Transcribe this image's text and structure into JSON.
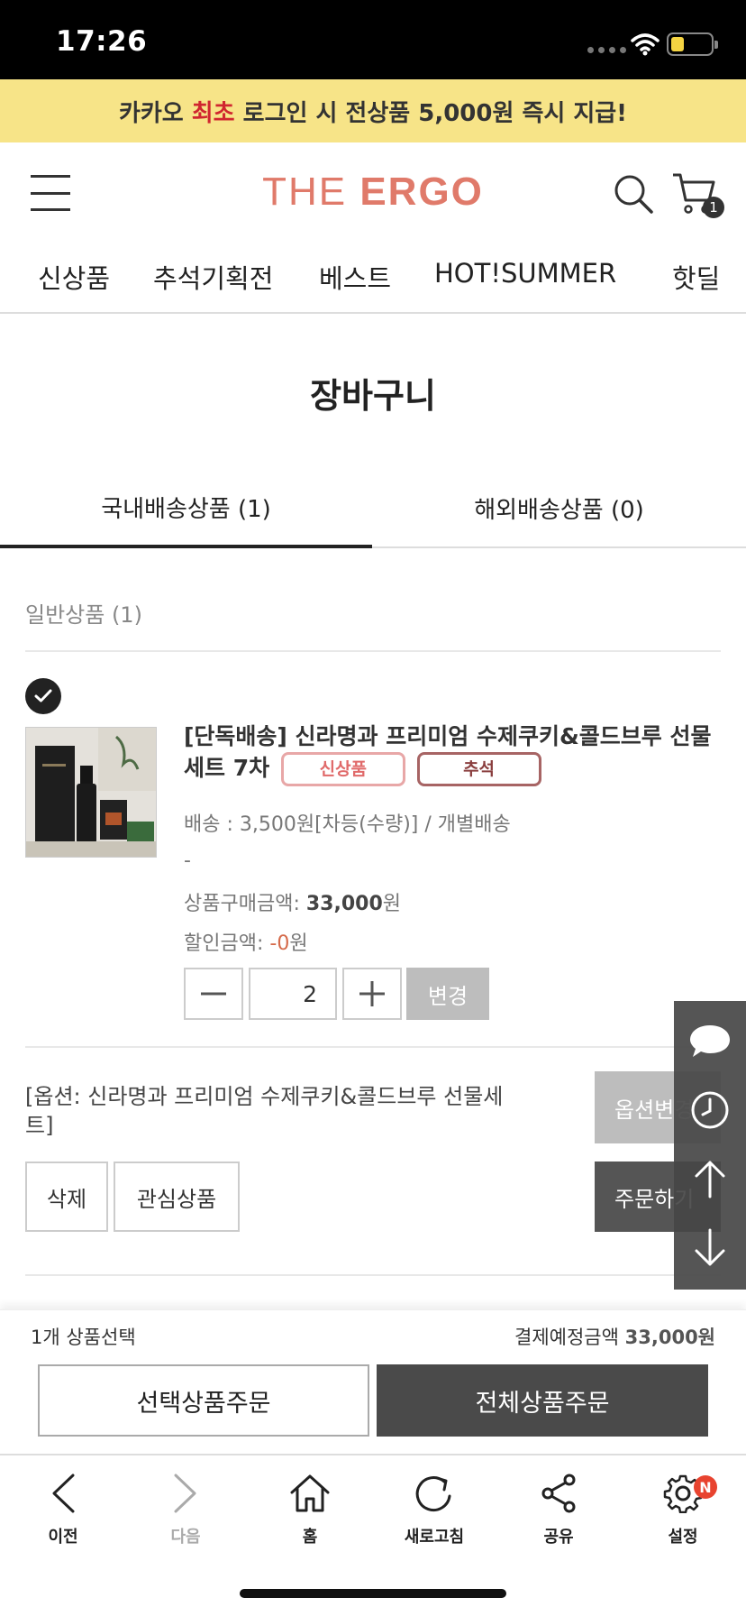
{
  "status_bar": {
    "time": "17:26"
  },
  "promo": {
    "before": "카카오 ",
    "highlight": "최초",
    "after": " 로그인 시 전상품 5,000원 즉시 지급!"
  },
  "header": {
    "logo_light": "THE ",
    "logo_bold": "ERGO",
    "cart_count": "1"
  },
  "gnb": [
    "신상품",
    "추석기획전",
    "베스트",
    "HOT!SUMMER",
    "핫딜"
  ],
  "page_title": "장바구니",
  "tabs": {
    "domestic": "국내배송상품  (1)",
    "overseas": "해외배송상품  (0)"
  },
  "section_label": "일반상품 (1)",
  "product": {
    "title": "[단독배송] 신라명과 프리미엄 수제쿠키&콜드브루 선물세트 7차",
    "tags": [
      "신상품",
      "추석"
    ],
    "shipping": "배송 : 3,500원[차등(수량)] / 개별배송",
    "dash": "-",
    "price_label": "상품구매금액: ",
    "price_value": "33,000",
    "price_unit": "원",
    "discount_label": "할인금액: ",
    "discount_value": "-0",
    "discount_unit": "원",
    "quantity": "2",
    "change_label": "변경",
    "option": "[옵션: 신라명과 프리미엄 수제쿠키&콜드브루 선물세트]",
    "delete_label": "삭제",
    "wish_label": "관심상품",
    "option_change_label": "옵션변경",
    "order_label": "주문하기"
  },
  "summary": {
    "selected": "1개 상품선택",
    "total_label": "결제예정금액 ",
    "total_value": "33,000원",
    "select_order": "선택상품주문",
    "all_order": "전체상품주문"
  },
  "browser_bar": [
    {
      "label": "이전",
      "icon": "back-icon"
    },
    {
      "label": "다음",
      "icon": "forward-icon"
    },
    {
      "label": "홈",
      "icon": "home-icon"
    },
    {
      "label": "새로고침",
      "icon": "refresh-icon"
    },
    {
      "label": "공유",
      "icon": "share-icon"
    },
    {
      "label": "설정",
      "icon": "gear-icon",
      "badge": "N"
    }
  ],
  "colors": {
    "banner_bg": "#f7e488",
    "accent_red": "#d0262f",
    "logo": "#e07a6a",
    "dark_button": "#4a4a4a"
  }
}
